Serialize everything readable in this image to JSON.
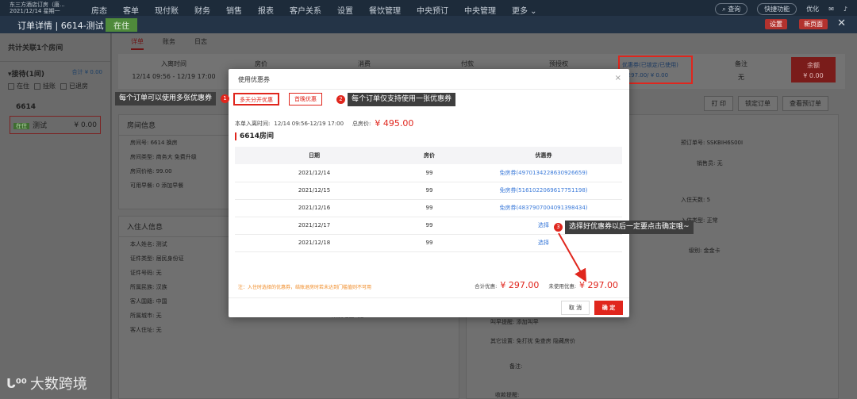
{
  "topnav": {
    "brand_line1": "东三方酒店订房（唐...",
    "brand_line2": "2021/12/14 星期一",
    "menu": [
      "房态",
      "客单",
      "现付账",
      "财务",
      "销售",
      "报表",
      "客户关系",
      "设置",
      "餐饮管理",
      "中央预订",
      "中央管理",
      "更多 ⌄"
    ],
    "search_label": "查询",
    "shortcut_label": "快捷功能",
    "user_label": "优化"
  },
  "header": {
    "title": "订单详情 | 6614-测试",
    "status": "在住",
    "btn_settings": "设置",
    "btn_new_page": "新页面",
    "close": "✕"
  },
  "sidebar": {
    "title": "共计关联1个房间",
    "group_label": "▾接待(1间)",
    "group_total": "合计 ¥ 0.00",
    "filters": [
      "在住",
      "挂账",
      "已退房"
    ],
    "room_number": "6614",
    "room_tag": "在住",
    "room_name": "测试",
    "room_amount": "¥ 0.00"
  },
  "tabs": [
    "详单",
    "账务",
    "日志"
  ],
  "summary": {
    "checkin_label": "入离时间",
    "checkin_value": "12/14 09:56 - 12/19 17:00",
    "price_label": "房价",
    "consume_label": "消费",
    "paid_label": "付款",
    "preauth_label": "预授权",
    "coupon_label": "优惠券(已锁定/已使用)",
    "coupon_value": "¥ 297.00/ ¥ 0.00",
    "remark_label": "备注",
    "remark_value": "无",
    "balance_label": "余额",
    "balance_value": "¥ 0.00"
  },
  "actions": [
    "打 印",
    "锁定订单",
    "查看预订单"
  ],
  "room_info": {
    "title": "房间信息",
    "rows": [
      "房间号: 6614  换房",
      "房间类型: 商务大  免费升级",
      "房间价格: 99.00",
      "可用早餐: 0  添加早餐"
    ]
  },
  "guest_info": {
    "title": "入住人信息",
    "rows": [
      "本人姓名: 测试",
      "证件类型: 居民身份证",
      "证件号码: 无",
      "所属民族: 汉族",
      "客人国籍: 中国",
      "所属城市: 无",
      "客人住址: 无"
    ],
    "region": "所属地区: 无"
  },
  "right_info": {
    "order_no": "预订单号: SSKBIH6S00I",
    "sales": "销售员: 无",
    "days": "入住天数: 5",
    "checkin_type": "入住类型: 正常",
    "level": "级别: 金金卡",
    "request": "叫早提醒: 添加叫早",
    "other": "其它设置:  免打扰   免查房   隐藏房价",
    "remark": "备注:",
    "receipt": "收款提醒:"
  },
  "modal": {
    "title": "使用优惠券",
    "close": "×",
    "tab_multi": "多天分开优惠",
    "tab_first": "首晚优惠",
    "info_label": "本单入离时间:",
    "info_dates": "12/14 09:56-12/19 17:00",
    "info_total_label": "总房价:",
    "info_total": "¥ 495.00",
    "room_title": "6614房间",
    "columns": [
      "日期",
      "房价",
      "优惠券"
    ],
    "rows": [
      {
        "date": "2021/12/14",
        "price": "99",
        "coupon": "免房券(4970134228630926659)"
      },
      {
        "date": "2021/12/15",
        "price": "99",
        "coupon": "免房券(5161022069617751198)"
      },
      {
        "date": "2021/12/16",
        "price": "99",
        "coupon": "免房券(4837907004091398434)"
      },
      {
        "date": "2021/12/17",
        "price": "99",
        "coupon": "选择"
      },
      {
        "date": "2021/12/18",
        "price": "99",
        "coupon": "选择"
      }
    ],
    "note": "注：入住时选择的优惠券，结账退房时若未达到门槛值则不可用",
    "total_discount_label": "合计优惠:",
    "total_discount": "¥ 297.00",
    "unused_label": "未使用优惠:",
    "unused": "¥ 297.00",
    "cancel": "取 消",
    "confirm": "确 定"
  },
  "annotations": {
    "a1_num": "1",
    "a1_text": "每个订单可以使用多张优惠券",
    "a2_num": "2",
    "a2_text": "每个订单仅支持使用一张优惠券",
    "a3_num": "3",
    "a3_text": "选择好优惠券以后一定要点击确定哦~"
  },
  "watermark": {
    "logo": "ᒐ⁰⁰",
    "text": "大数跨境"
  },
  "colors": {
    "accent": "#e0261d",
    "link": "#3b7ad9",
    "nav": "#1d2b3a"
  }
}
